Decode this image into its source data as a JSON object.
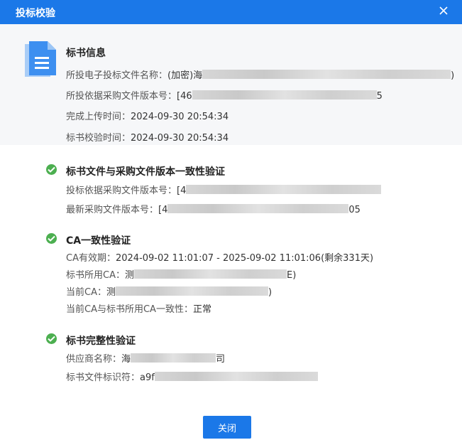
{
  "dialog": {
    "title": "投标校验",
    "close_button": "关闭"
  },
  "bid_info": {
    "title": "标书信息",
    "file_name_label": "所投电子投标文件名称：",
    "file_name_value": "(加密)海",
    "file_name_tail": ")",
    "version_label": "所投依据采购文件版本号：",
    "version_value": "[46",
    "version_tail": "5",
    "upload_time_label": "完成上传时间：",
    "upload_time_value": "2024-09-30 20:54:34",
    "verify_time_label": "标书校验时间：",
    "verify_time_value": "2024-09-30 20:54:34"
  },
  "sections": {
    "version_check": {
      "title": "标书文件与采购文件版本一致性验证",
      "bid_version_label": "投标依据采购文件版本号：",
      "bid_version_value": "[4",
      "latest_version_label": "最新采购文件版本号：",
      "latest_version_value": "[4",
      "latest_version_tail": "05"
    },
    "ca_check": {
      "title": "CA一致性验证",
      "validity_label": "CA有效期：",
      "validity_value": "2024-09-02 11:01:07 - 2025-09-02 11:01:06(剩余331天)",
      "bid_ca_label": "标书所用CA：",
      "bid_ca_value": "测",
      "bid_ca_tail": "E)",
      "current_ca_label": "当前CA：",
      "current_ca_value": "测",
      "current_ca_tail": ")",
      "consistency_label": "当前CA与标书所用CA一致性：",
      "consistency_value": "正常"
    },
    "integrity_check": {
      "title": "标书完整性验证",
      "supplier_label": "供应商名称：",
      "supplier_value": "海",
      "supplier_tail": "司",
      "file_id_label": "标书文件标识符：",
      "file_id_value": "a9f"
    }
  },
  "colors": {
    "accent": "#1b78e8",
    "success": "#4caf50",
    "panel_bg": "#f6f7f9"
  },
  "icons": {
    "dialog_close": "close-icon",
    "document": "document-icon",
    "check": "check-circle-icon"
  }
}
